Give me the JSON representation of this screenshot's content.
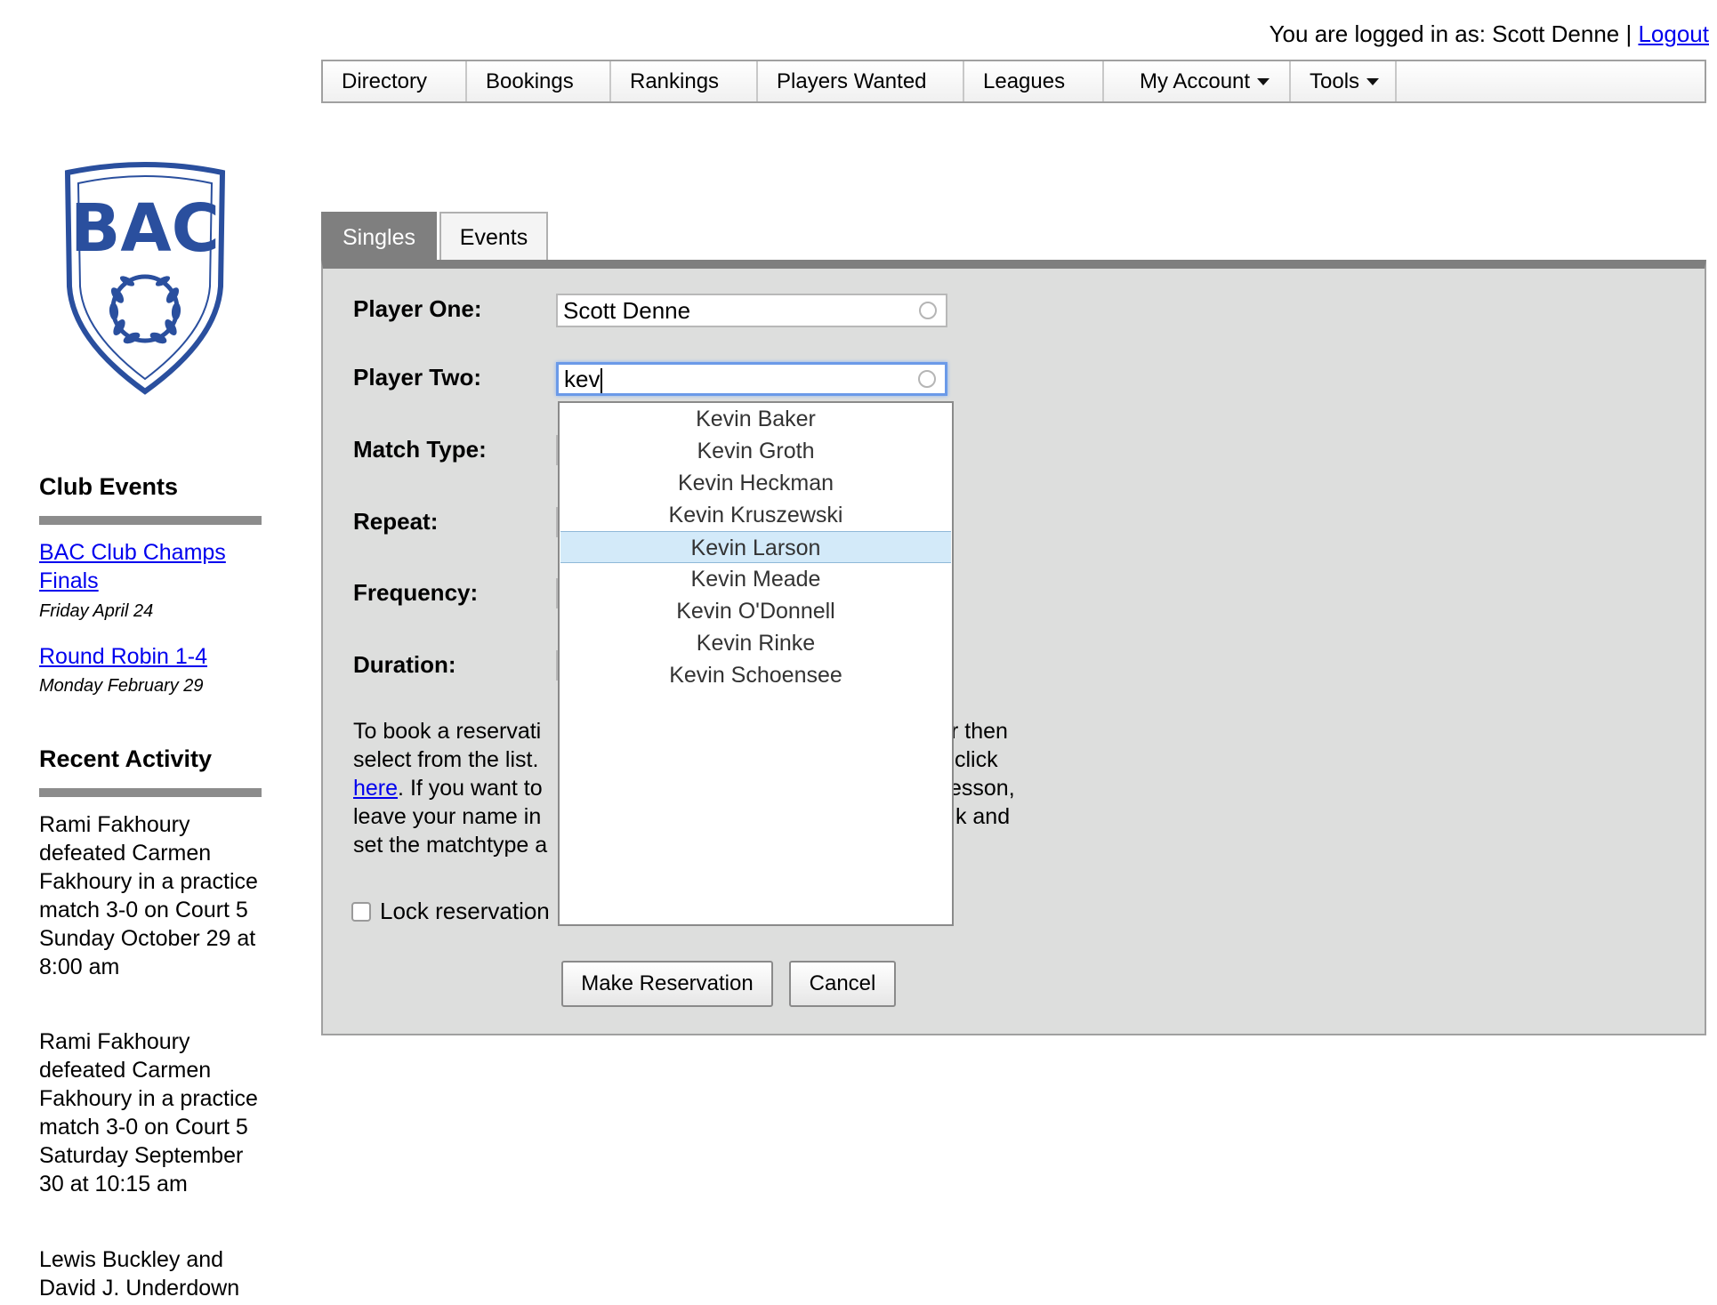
{
  "header": {
    "logged_in_prefix": "You are logged in as: Scott Denne |",
    "logout_label": "Logout"
  },
  "nav": {
    "items": [
      {
        "label": "Directory"
      },
      {
        "label": "Bookings"
      },
      {
        "label": "Rankings"
      },
      {
        "label": "Players Wanted"
      },
      {
        "label": "Leagues"
      },
      {
        "label": "My Account"
      },
      {
        "label": "Tools"
      }
    ]
  },
  "logo": {
    "text": "BAC"
  },
  "sidebar": {
    "club_events_title": "Club Events",
    "events": [
      {
        "title": "BAC Club Champs Finals",
        "date": "Friday April 24"
      },
      {
        "title": "Round Robin 1-4",
        "date": "Monday February 29"
      }
    ],
    "recent_activity_title": "Recent Activity",
    "activity": [
      "Rami Fakhoury defeated Carmen Fakhoury in a practice match 3-0 on Court 5 Sunday October 29 at 8:00 am",
      "Rami Fakhoury defeated Carmen Fakhoury in a practice match 3-0 on Court 5 Saturday September 30 at 10:15 am",
      "Lewis Buckley and David J. Underdown"
    ]
  },
  "tabs": {
    "singles": "Singles",
    "events": "Events"
  },
  "form": {
    "player_one_label": "Player One:",
    "player_one_value": "Scott Denne",
    "player_two_label": "Player Two:",
    "player_two_value": "kev",
    "match_type_label": "Match Type:",
    "repeat_label": "Repeat:",
    "frequency_label": "Frequency:",
    "duration_label": "Duration:",
    "help_line1_a": "To book a reservati",
    "help_line1_b": "r then",
    "help_line2_a": "select from the list.",
    "help_line2_b": "click",
    "help_link": "here",
    "help_line3_a": ". If you want to",
    "help_line3_b": "esson,",
    "help_line4_a": "leave your name in",
    "help_line4_b": "ık and",
    "help_line5_a": "set the matchtype a",
    "lock_label": "Lock reservation",
    "make_reservation": "Make Reservation",
    "cancel": "Cancel"
  },
  "autocomplete": {
    "options": [
      "Kevin Baker",
      "Kevin Groth",
      "Kevin Heckman",
      "Kevin Kruszewski",
      "Kevin Larson",
      "Kevin Meade",
      "Kevin O'Donnell",
      "Kevin Rinke",
      "Kevin Schoensee"
    ],
    "selected": "Kevin Larson"
  },
  "colors": {
    "link": "#0000ee",
    "brand_blue": "#2a4f9e",
    "tab_active": "#7f7f7f",
    "panel_bg": "#dddedd",
    "dropdown_highlight": "#d3eaf9"
  }
}
